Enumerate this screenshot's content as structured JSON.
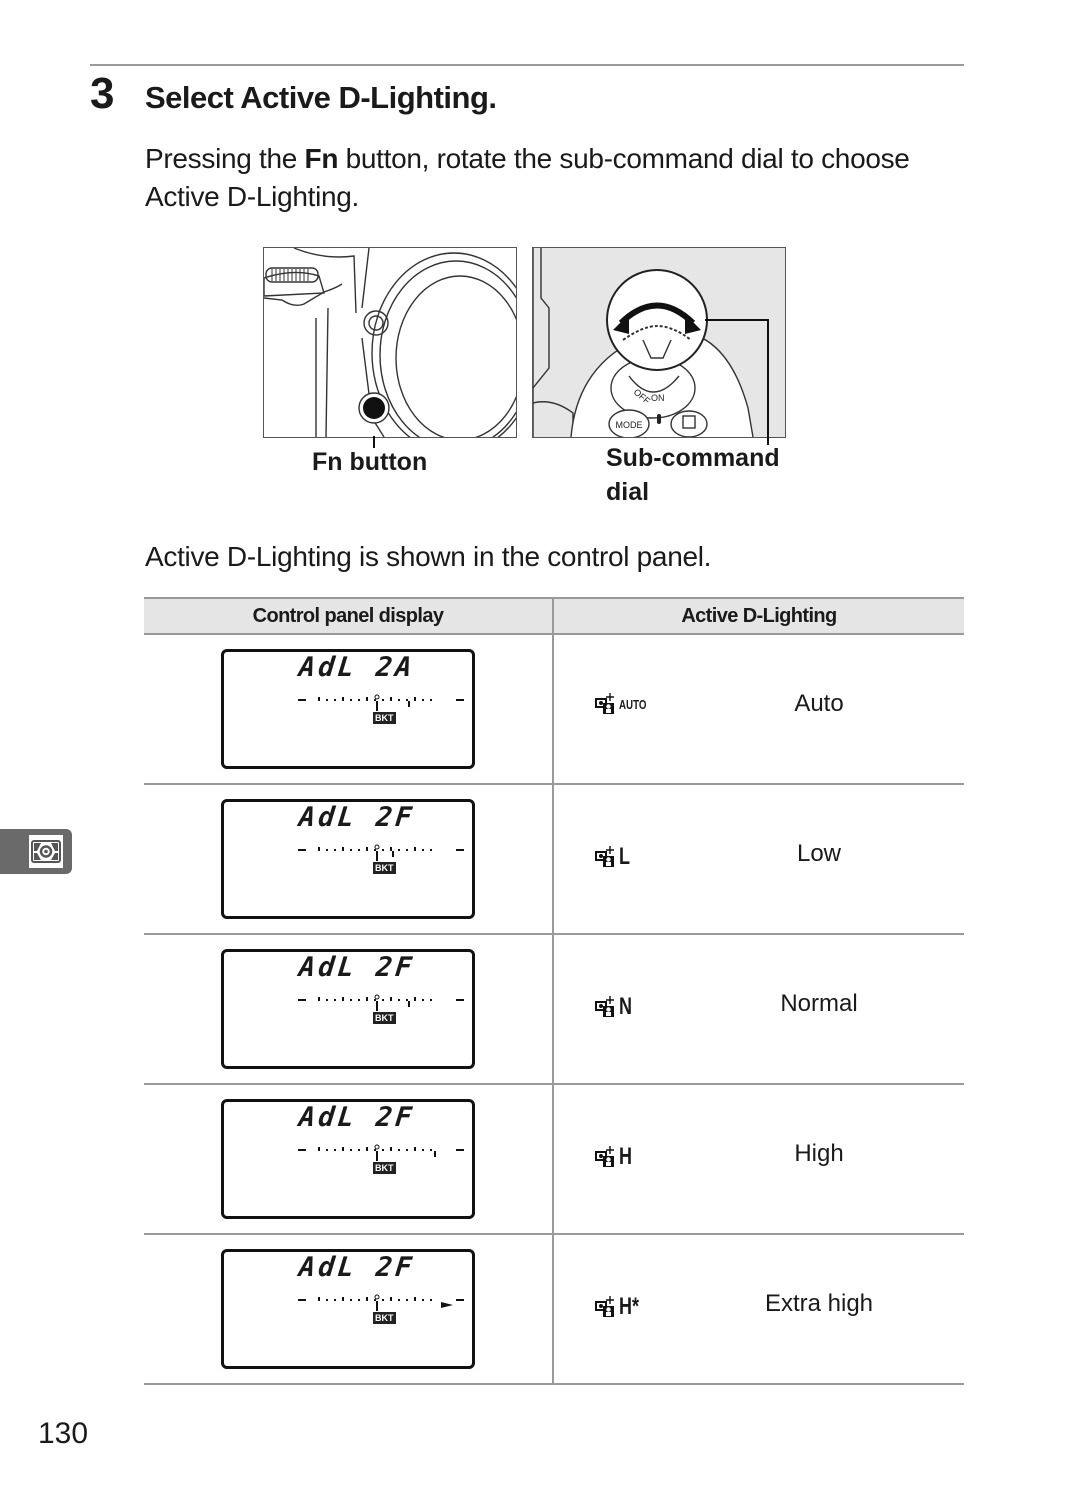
{
  "step": {
    "number": "3",
    "title": "Select Active D-Lighting.",
    "body_prefix": "Pressing the ",
    "body_button": "Fn",
    "body_suffix": " button, rotate the sub-command dial to choose Active D-Lighting."
  },
  "figures": {
    "fn_button_label": "Fn button",
    "sub_command_label_line1": "Sub-command",
    "sub_command_label_line2": "dial",
    "dial_marks": {
      "off": "OFF",
      "on": "ON",
      "mode": "MODE"
    }
  },
  "panel_note": "Active D-Lighting is shown in the control panel.",
  "table": {
    "headers": [
      "Control panel display",
      "Active D-Lighting"
    ],
    "rows": [
      {
        "lcd": "AdL  2A",
        "bkt": "BKT",
        "icon": "adl-icon",
        "code": "AUTO",
        "name": "Auto",
        "indicator_level": 2
      },
      {
        "lcd": "AdL  2F",
        "bkt": "BKT",
        "icon": "adl-icon",
        "code": "L",
        "name": "Low",
        "indicator_level": 1
      },
      {
        "lcd": "AdL  2F",
        "bkt": "BKT",
        "icon": "adl-icon",
        "code": "N",
        "name": "Normal",
        "indicator_level": 2
      },
      {
        "lcd": "AdL  2F",
        "bkt": "BKT",
        "icon": "adl-icon",
        "code": "H",
        "name": "High",
        "indicator_level": 3
      },
      {
        "lcd": "AdL  2F",
        "bkt": "BKT",
        "icon": "adl-icon",
        "code": "H*",
        "name": "Extra high",
        "indicator_level": 4
      }
    ]
  },
  "side_tab": {
    "icon": "metering-icon"
  },
  "page_number": "130",
  "colors": {
    "rule": "#9a9a9a",
    "header_bg": "#e5e5e5",
    "side_tab": "#6a6a6a"
  }
}
